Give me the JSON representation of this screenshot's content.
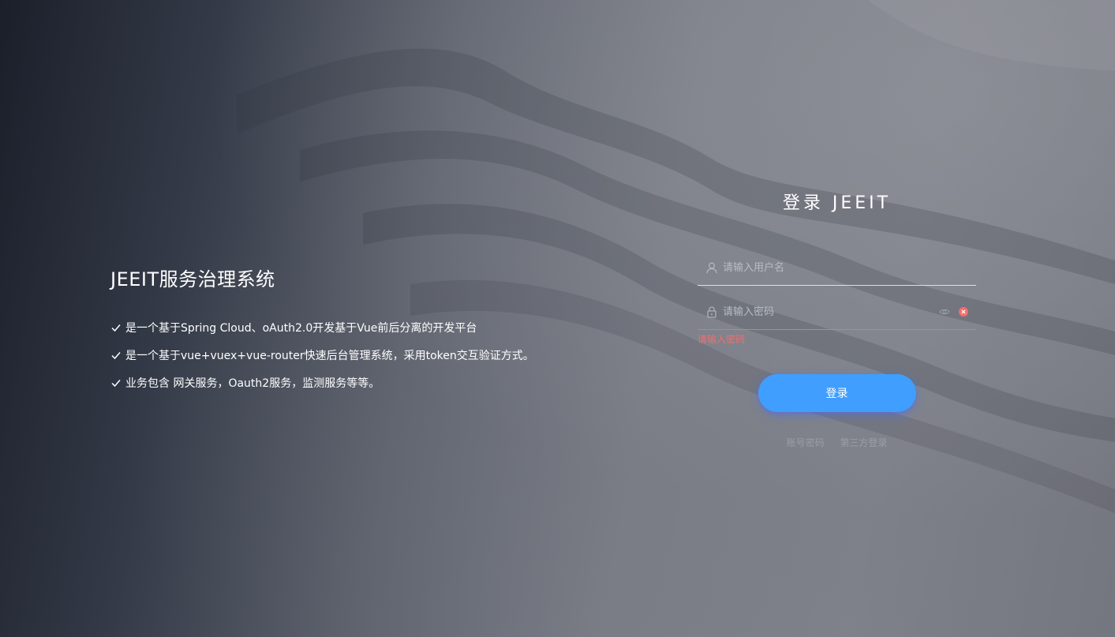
{
  "intro": {
    "title": "JEEIT服务治理系统",
    "features": [
      "是一个基于Spring Cloud、oAuth2.0开发基于Vue前后分离的开发平台",
      "是一个基于vue+vuex+vue-router快速后台管理系统，采用token交互验证方式。",
      "业务包含 网关服务，Oauth2服务，监测服务等等。"
    ]
  },
  "login": {
    "title": "登录 JEEIT",
    "username": {
      "placeholder": "请输入用户名",
      "value": "",
      "icon": "user-icon"
    },
    "password": {
      "placeholder": "请输入密码",
      "value": "",
      "icon": "lock-icon",
      "error": "请输入密码"
    },
    "submit_label": "登录",
    "links": [
      "账号密码",
      "第三方登录"
    ]
  },
  "colors": {
    "accent": "#409eff",
    "error": "#f56c6c"
  }
}
